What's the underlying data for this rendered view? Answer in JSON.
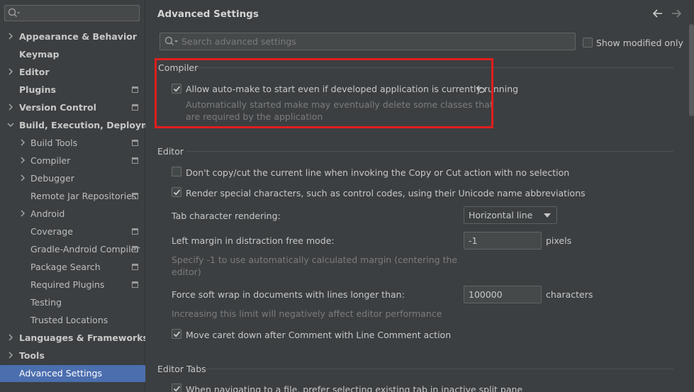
{
  "sidebar": {
    "search_placeholder": "",
    "items": [
      {
        "label": "Appearance & Behavior"
      },
      {
        "label": "Keymap"
      },
      {
        "label": "Editor"
      },
      {
        "label": "Plugins"
      },
      {
        "label": "Version Control"
      },
      {
        "label": "Build, Execution, Deployment"
      },
      {
        "label": "Build Tools"
      },
      {
        "label": "Compiler"
      },
      {
        "label": "Debugger"
      },
      {
        "label": "Remote Jar Repositories"
      },
      {
        "label": "Android"
      },
      {
        "label": "Coverage"
      },
      {
        "label": "Gradle-Android Compiler"
      },
      {
        "label": "Package Search"
      },
      {
        "label": "Required Plugins"
      },
      {
        "label": "Testing"
      },
      {
        "label": "Trusted Locations"
      },
      {
        "label": "Languages & Frameworks"
      },
      {
        "label": "Tools"
      },
      {
        "label": "Advanced Settings"
      }
    ]
  },
  "main": {
    "title": "Advanced Settings",
    "search_placeholder": "Search advanced settings",
    "show_modified_label": "Show modified only",
    "sections": {
      "compiler": {
        "title": "Compiler",
        "automake_label": "Allow auto-make to start even if developed application is currently running",
        "automake_hint_1": "Automatically started make may eventually delete some classes that",
        "automake_hint_2": "are required by the application"
      },
      "editor": {
        "title": "Editor",
        "dont_copy_label": "Don't copy/cut the current line when invoking the Copy or Cut action with no selection",
        "render_special_label": "Render special characters, such as control codes, using their Unicode name abbreviations",
        "tab_rendering_label": "Tab character rendering:",
        "tab_rendering_value": "Horizontal line",
        "left_margin_label": "Left margin in distraction free mode:",
        "left_margin_value": "-1",
        "left_margin_unit": "pixels",
        "left_margin_hint_1": "Specify -1 to use automatically calculated margin (centering the",
        "left_margin_hint_2": "editor)",
        "soft_wrap_label": "Force soft wrap in documents with lines longer than:",
        "soft_wrap_value": "100000",
        "soft_wrap_unit": "characters",
        "soft_wrap_hint": "Increasing this limit will negatively affect editor performance",
        "move_caret_label": "Move caret down after Comment with Line Comment action"
      },
      "editor_tabs": {
        "title": "Editor Tabs",
        "navigate_label": "When navigating to a file, prefer selecting existing tab in inactive split pane"
      }
    }
  },
  "colors": {
    "background": "#3c3f41",
    "selection": "#4b6eaf",
    "highlight_box": "#e01e1e"
  }
}
